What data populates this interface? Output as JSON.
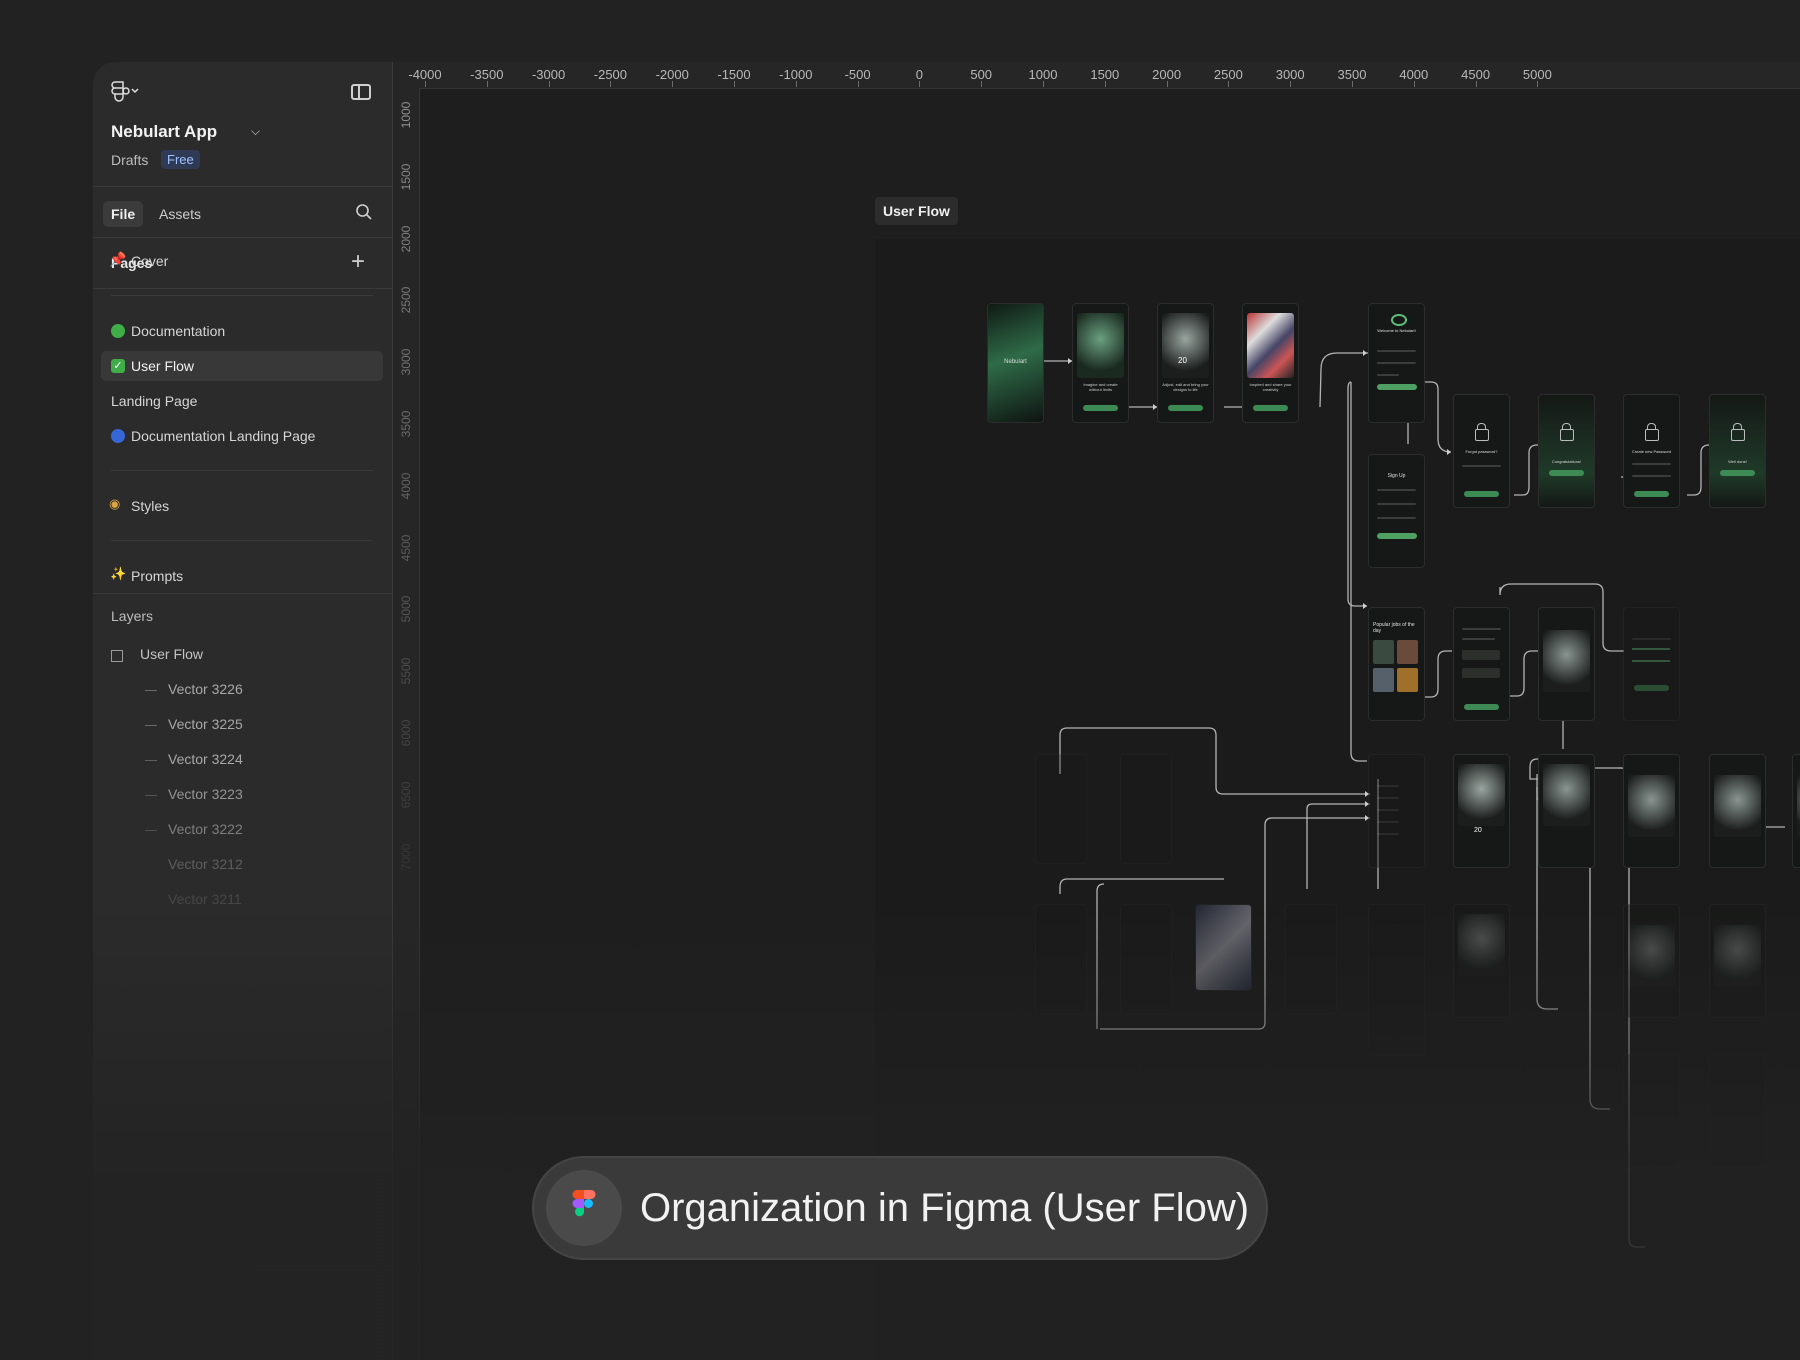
{
  "app": {
    "name": "Nebulart App",
    "drafts_label": "Drafts",
    "plan_badge": "Free"
  },
  "tabs": {
    "file": "File",
    "assets": "Assets"
  },
  "pages": {
    "title": "Pages",
    "items": [
      {
        "label": "Cover",
        "icon": "pushpin-icon"
      },
      {
        "label": "Documentation",
        "icon": "green-circle-icon",
        "color": "#3fae49"
      },
      {
        "label": "User Flow",
        "icon": "check-box-icon",
        "color": "#3fae49",
        "active": true
      },
      {
        "label": "Landing Page"
      },
      {
        "label": "Documentation Landing Page",
        "icon": "blue-circle-icon",
        "color": "#3567d6"
      },
      {
        "label": "Styles",
        "icon": "palette-icon"
      },
      {
        "label": "Prompts",
        "icon": "sparkles-icon"
      }
    ]
  },
  "layers": {
    "title": "Layers",
    "root": "User Flow",
    "items": [
      "Vector 3226",
      "Vector 3225",
      "Vector 3224",
      "Vector 3223",
      "Vector 3222",
      "Vector 3212",
      "Vector 3211"
    ]
  },
  "ruler": {
    "top": [
      "-4000",
      "-3500",
      "-3000",
      "-2500",
      "-2000",
      "-1500",
      "-1000",
      "-500",
      "0",
      "500",
      "1000",
      "1500",
      "2000",
      "2500",
      "3000",
      "3500",
      "4000",
      "4500",
      "5000"
    ],
    "left": [
      "1000",
      "1500",
      "2000",
      "2500",
      "3000",
      "3500",
      "4000",
      "4500",
      "5000",
      "5500",
      "6000",
      "6500",
      "7000"
    ]
  },
  "canvas": {
    "frame_label": "User Flow",
    "screens": {
      "splash": "Nebulart",
      "onboarding_1": "Imagine and create without limits",
      "onboarding_2": "Adjust, edit and bring your designs to life",
      "onboarding_3": "Inspired and share your creativity",
      "welcome": "Welcome to Nebulart!",
      "forgot": "Forgot password?",
      "congrats": "Congratulations!",
      "create_password": "Create new Password",
      "well_done": "Well done!",
      "sign_up": "Sign Up",
      "popular": "Popular jobs of the day",
      "counter": "20"
    }
  },
  "caption": {
    "text": "Organization in Figma (User Flow)",
    "icon": "figma-logo-icon"
  }
}
